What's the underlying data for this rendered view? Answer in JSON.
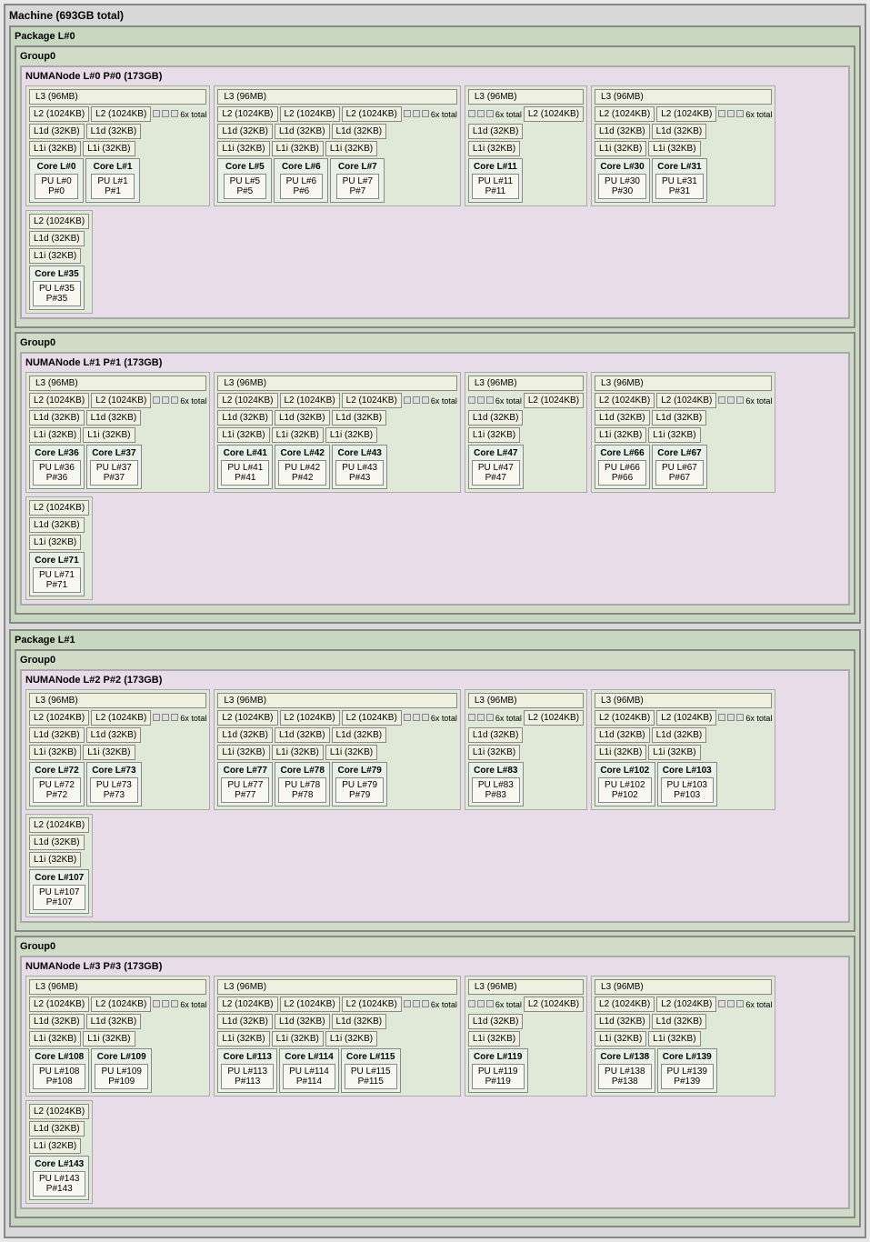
{
  "machine": {
    "title": "Machine (693GB total)",
    "packages": [
      {
        "id": "pkg0",
        "label": "Package L#0",
        "groups": [
          {
            "label": "Group0",
            "numa": {
              "label": "NUMANode L#0 P#0 (173GB)",
              "segments": [
                {
                  "l3": "L3 (96MB)",
                  "l2s": [
                    "L2 (1024KB)",
                    "L2 (1024KB)"
                  ],
                  "extra_label": "6x total",
                  "l1ds": [
                    "L1d (32KB)",
                    "L1d (32KB)"
                  ],
                  "l1is": [
                    "L1i (32KB)",
                    "L1i (32KB)"
                  ],
                  "cores": [
                    {
                      "label": "Core L#0",
                      "pu_label": "PU L#0\nP#0"
                    },
                    {
                      "label": "Core L#1",
                      "pu_label": "PU L#1\nP#1"
                    }
                  ]
                },
                {
                  "l3": "L3 (96MB)",
                  "l2s": [
                    "L2 (1024KB)",
                    "L2 (1024KB)",
                    "L2 (1024KB)"
                  ],
                  "extra_label": "6x total",
                  "l1ds": [
                    "L1d (32KB)",
                    "L1d (32KB)",
                    "L1d (32KB)"
                  ],
                  "l1is": [
                    "L1i (32KB)",
                    "L1i (32KB)",
                    "L1i (32KB)"
                  ],
                  "cores": [
                    {
                      "label": "Core L#5",
                      "pu_label": "PU L#5\nP#5"
                    },
                    {
                      "label": "Core L#6",
                      "pu_label": "PU L#6\nP#6"
                    },
                    {
                      "label": "Core L#7",
                      "pu_label": "PU L#7\nP#7"
                    }
                  ]
                },
                {
                  "l3": "L3 (96MB)",
                  "extra_only": true,
                  "extra_label": "6x total",
                  "l2s": [
                    "L2 (1024KB)"
                  ],
                  "l1ds": [
                    "L1d (32KB)"
                  ],
                  "l1is": [
                    "L1i (32KB)"
                  ],
                  "cores": [
                    {
                      "label": "Core L#11",
                      "pu_label": "PU L#11\nP#11"
                    }
                  ]
                },
                {
                  "l3": "L3 (96MB)",
                  "l2s": [
                    "L2 (1024KB)",
                    "L2 (1024KB)"
                  ],
                  "extra_label": "6x total",
                  "l1ds": [
                    "L1d (32KB)",
                    "L1d (32KB)"
                  ],
                  "l1is": [
                    "L1i (32KB)",
                    "L1i (32KB)"
                  ],
                  "cores": [
                    {
                      "label": "Core L#30",
                      "pu_label": "PU L#30\nP#30"
                    },
                    {
                      "label": "Core L#31",
                      "pu_label": "PU L#31\nP#31"
                    }
                  ]
                },
                {
                  "l3": null,
                  "l2s": [
                    "L2 (1024KB)"
                  ],
                  "extra_label": null,
                  "l1ds": [
                    "L1d (32KB)"
                  ],
                  "l1is": [
                    "L1i (32KB)"
                  ],
                  "cores": [
                    {
                      "label": "Core L#35",
                      "pu_label": "PU L#35\nP#35"
                    }
                  ]
                }
              ]
            }
          },
          {
            "label": "Group0",
            "numa": {
              "label": "NUMANode L#1 P#1 (173GB)",
              "segments": [
                {
                  "l3": "L3 (96MB)",
                  "l2s": [
                    "L2 (1024KB)",
                    "L2 (1024KB)"
                  ],
                  "extra_label": "6x total",
                  "l1ds": [
                    "L1d (32KB)",
                    "L1d (32KB)"
                  ],
                  "l1is": [
                    "L1i (32KB)",
                    "L1i (32KB)"
                  ],
                  "cores": [
                    {
                      "label": "Core L#36",
                      "pu_label": "PU L#36\nP#36"
                    },
                    {
                      "label": "Core L#37",
                      "pu_label": "PU L#37\nP#37"
                    }
                  ]
                },
                {
                  "l3": "L3 (96MB)",
                  "l2s": [
                    "L2 (1024KB)",
                    "L2 (1024KB)",
                    "L2 (1024KB)"
                  ],
                  "extra_label": "6x total",
                  "l1ds": [
                    "L1d (32KB)",
                    "L1d (32KB)",
                    "L1d (32KB)"
                  ],
                  "l1is": [
                    "L1i (32KB)",
                    "L1i (32KB)",
                    "L1i (32KB)"
                  ],
                  "cores": [
                    {
                      "label": "Core L#41",
                      "pu_label": "PU L#41\nP#41"
                    },
                    {
                      "label": "Core L#42",
                      "pu_label": "PU L#42\nP#42"
                    },
                    {
                      "label": "Core L#43",
                      "pu_label": "PU L#43\nP#43"
                    }
                  ]
                },
                {
                  "l3": "L3 (96MB)",
                  "extra_only": true,
                  "extra_label": "6x total",
                  "l2s": [
                    "L2 (1024KB)"
                  ],
                  "l1ds": [
                    "L1d (32KB)"
                  ],
                  "l1is": [
                    "L1i (32KB)"
                  ],
                  "cores": [
                    {
                      "label": "Core L#47",
                      "pu_label": "PU L#47\nP#47"
                    }
                  ]
                },
                {
                  "l3": "L3 (96MB)",
                  "l2s": [
                    "L2 (1024KB)",
                    "L2 (1024KB)"
                  ],
                  "extra_label": "6x total",
                  "l1ds": [
                    "L1d (32KB)",
                    "L1d (32KB)"
                  ],
                  "l1is": [
                    "L1i (32KB)",
                    "L1i (32KB)"
                  ],
                  "cores": [
                    {
                      "label": "Core L#66",
                      "pu_label": "PU L#66\nP#66"
                    },
                    {
                      "label": "Core L#67",
                      "pu_label": "PU L#67\nP#67"
                    }
                  ]
                },
                {
                  "l3": null,
                  "l2s": [
                    "L2 (1024KB)"
                  ],
                  "extra_label": null,
                  "l1ds": [
                    "L1d (32KB)"
                  ],
                  "l1is": [
                    "L1i (32KB)"
                  ],
                  "cores": [
                    {
                      "label": "Core L#71",
                      "pu_label": "PU L#71\nP#71"
                    }
                  ]
                }
              ]
            }
          }
        ]
      },
      {
        "id": "pkg1",
        "label": "Package L#1",
        "groups": [
          {
            "label": "Group0",
            "numa": {
              "label": "NUMANode L#2 P#2 (173GB)",
              "segments": [
                {
                  "l3": "L3 (96MB)",
                  "l2s": [
                    "L2 (1024KB)",
                    "L2 (1024KB)"
                  ],
                  "extra_label": "6x total",
                  "l1ds": [
                    "L1d (32KB)",
                    "L1d (32KB)"
                  ],
                  "l1is": [
                    "L1i (32KB)",
                    "L1i (32KB)"
                  ],
                  "cores": [
                    {
                      "label": "Core L#72",
                      "pu_label": "PU L#72\nP#72"
                    },
                    {
                      "label": "Core L#73",
                      "pu_label": "PU L#73\nP#73"
                    }
                  ]
                },
                {
                  "l3": "L3 (96MB)",
                  "l2s": [
                    "L2 (1024KB)",
                    "L2 (1024KB)",
                    "L2 (1024KB)"
                  ],
                  "extra_label": "6x total",
                  "l1ds": [
                    "L1d (32KB)",
                    "L1d (32KB)",
                    "L1d (32KB)"
                  ],
                  "l1is": [
                    "L1i (32KB)",
                    "L1i (32KB)",
                    "L1i (32KB)"
                  ],
                  "cores": [
                    {
                      "label": "Core L#77",
                      "pu_label": "PU L#77\nP#77"
                    },
                    {
                      "label": "Core L#78",
                      "pu_label": "PU L#78\nP#78"
                    },
                    {
                      "label": "Core L#79",
                      "pu_label": "PU L#79\nP#79"
                    }
                  ]
                },
                {
                  "l3": "L3 (96MB)",
                  "extra_only": true,
                  "extra_label": "6x total",
                  "l2s": [
                    "L2 (1024KB)"
                  ],
                  "l1ds": [
                    "L1d (32KB)"
                  ],
                  "l1is": [
                    "L1i (32KB)"
                  ],
                  "cores": [
                    {
                      "label": "Core L#83",
                      "pu_label": "PU L#83\nP#83"
                    }
                  ]
                },
                {
                  "l3": "L3 (96MB)",
                  "l2s": [
                    "L2 (1024KB)",
                    "L2 (1024KB)"
                  ],
                  "extra_label": "6x total",
                  "l1ds": [
                    "L1d (32KB)",
                    "L1d (32KB)"
                  ],
                  "l1is": [
                    "L1i (32KB)",
                    "L1i (32KB)"
                  ],
                  "cores": [
                    {
                      "label": "Core L#102",
                      "pu_label": "PU L#102\nP#102"
                    },
                    {
                      "label": "Core L#103",
                      "pu_label": "PU L#103\nP#103"
                    }
                  ]
                },
                {
                  "l3": null,
                  "l2s": [
                    "L2 (1024KB)"
                  ],
                  "extra_label": null,
                  "l1ds": [
                    "L1d (32KB)"
                  ],
                  "l1is": [
                    "L1i (32KB)"
                  ],
                  "cores": [
                    {
                      "label": "Core L#107",
                      "pu_label": "PU L#107\nP#107"
                    }
                  ]
                }
              ]
            }
          },
          {
            "label": "Group0",
            "numa": {
              "label": "NUMANode L#3 P#3 (173GB)",
              "segments": [
                {
                  "l3": "L3 (96MB)",
                  "l2s": [
                    "L2 (1024KB)",
                    "L2 (1024KB)"
                  ],
                  "extra_label": "6x total",
                  "l1ds": [
                    "L1d (32KB)",
                    "L1d (32KB)"
                  ],
                  "l1is": [
                    "L1i (32KB)",
                    "L1i (32KB)"
                  ],
                  "cores": [
                    {
                      "label": "Core L#108",
                      "pu_label": "PU L#108\nP#108"
                    },
                    {
                      "label": "Core L#109",
                      "pu_label": "PU L#109\nP#109"
                    }
                  ]
                },
                {
                  "l3": "L3 (96MB)",
                  "l2s": [
                    "L2 (1024KB)",
                    "L2 (1024KB)",
                    "L2 (1024KB)"
                  ],
                  "extra_label": "6x total",
                  "l1ds": [
                    "L1d (32KB)",
                    "L1d (32KB)",
                    "L1d (32KB)"
                  ],
                  "l1is": [
                    "L1i (32KB)",
                    "L1i (32KB)",
                    "L1i (32KB)"
                  ],
                  "cores": [
                    {
                      "label": "Core L#113",
                      "pu_label": "PU L#113\nP#113"
                    },
                    {
                      "label": "Core L#114",
                      "pu_label": "PU L#114\nP#114"
                    },
                    {
                      "label": "Core L#115",
                      "pu_label": "PU L#115\nP#115"
                    }
                  ]
                },
                {
                  "l3": "L3 (96MB)",
                  "extra_only": true,
                  "extra_label": "6x total",
                  "l2s": [
                    "L2 (1024KB)"
                  ],
                  "l1ds": [
                    "L1d (32KB)"
                  ],
                  "l1is": [
                    "L1i (32KB)"
                  ],
                  "cores": [
                    {
                      "label": "Core L#119",
                      "pu_label": "PU L#119\nP#119"
                    }
                  ]
                },
                {
                  "l3": "L3 (96MB)",
                  "l2s": [
                    "L2 (1024KB)",
                    "L2 (1024KB)"
                  ],
                  "extra_label": "6x total",
                  "l1ds": [
                    "L1d (32KB)",
                    "L1d (32KB)"
                  ],
                  "l1is": [
                    "L1i (32KB)",
                    "L1i (32KB)"
                  ],
                  "cores": [
                    {
                      "label": "Core L#138",
                      "pu_label": "PU L#138\nP#138"
                    },
                    {
                      "label": "Core L#139",
                      "pu_label": "PU L#139\nP#139"
                    }
                  ]
                },
                {
                  "l3": null,
                  "l2s": [
                    "L2 (1024KB)"
                  ],
                  "extra_label": null,
                  "l1ds": [
                    "L1d (32KB)"
                  ],
                  "l1is": [
                    "L1i (32KB)"
                  ],
                  "cores": [
                    {
                      "label": "Core L#143",
                      "pu_label": "PU L#143\nP#143"
                    }
                  ]
                }
              ]
            }
          }
        ]
      }
    ]
  }
}
